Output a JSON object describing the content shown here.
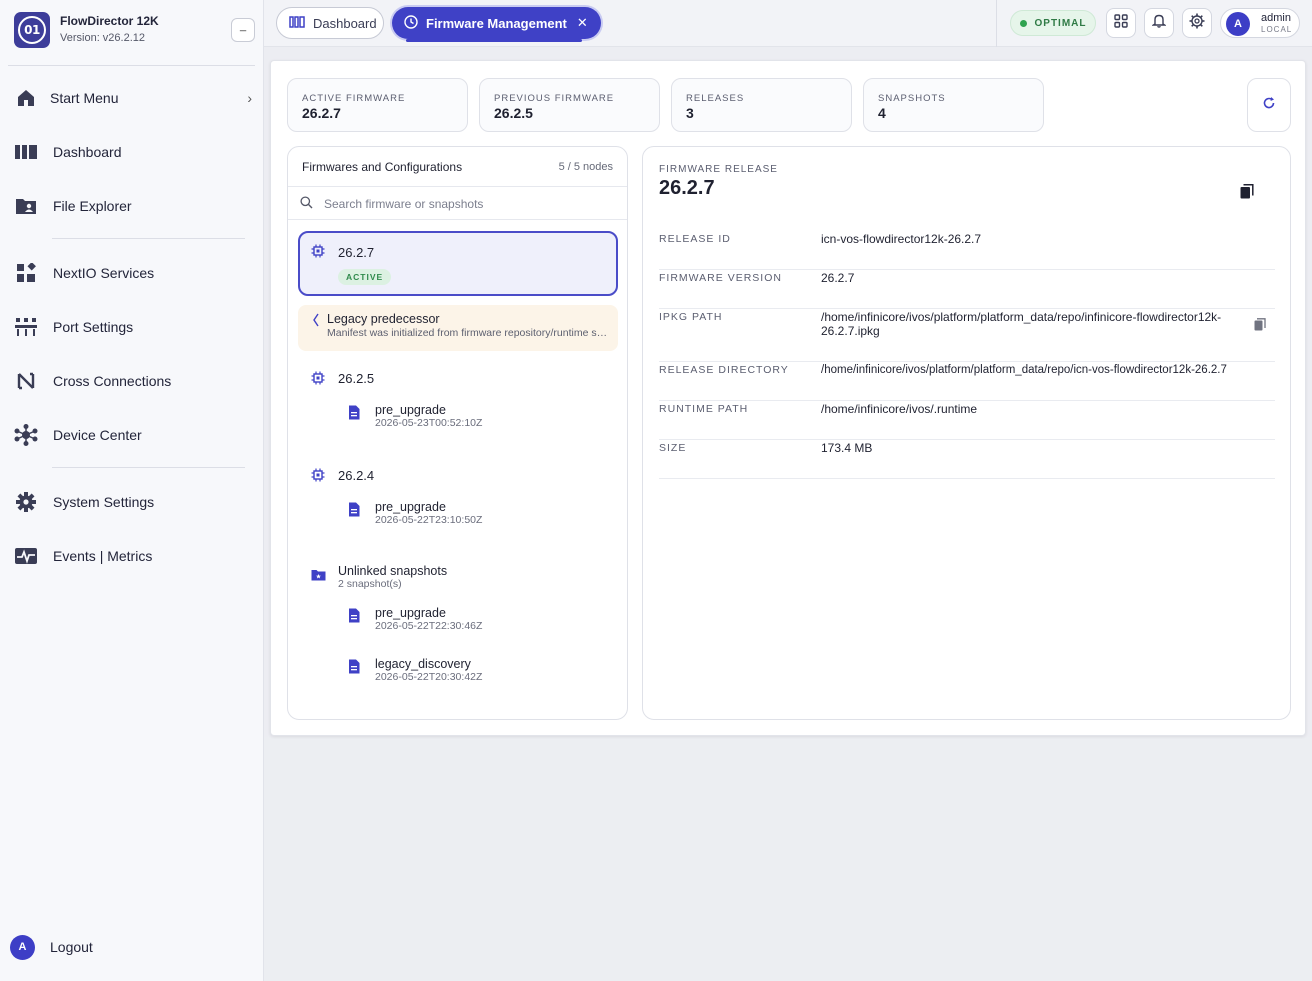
{
  "app": {
    "name": "FlowDirector 12K",
    "version": "Version: v26.2.12",
    "logo_text": "01"
  },
  "sidebar": {
    "collapse_label": "_",
    "items": [
      {
        "label": "Start Menu",
        "icon": "home-icon"
      },
      {
        "label": "Dashboard",
        "icon": "columns-icon"
      },
      {
        "label": "File Explorer",
        "icon": "folder-user-icon"
      },
      {
        "label": "NextIO Services",
        "icon": "widgets-icon"
      },
      {
        "label": "Port Settings",
        "icon": "ports-icon"
      },
      {
        "label": "Cross Connections",
        "icon": "cross-connect-icon"
      },
      {
        "label": "Device Center",
        "icon": "hub-icon"
      },
      {
        "label": "System Settings",
        "icon": "gear-icon"
      },
      {
        "label": "Events | Metrics",
        "icon": "pulse-icon"
      }
    ],
    "logout_label": "Logout",
    "logout_avatar": "A"
  },
  "topbar": {
    "tabs": [
      {
        "label": "Dashboard",
        "active": false
      },
      {
        "label": "Firmware Management",
        "active": true,
        "close": "✕"
      }
    ],
    "status": "OPTIMAL",
    "user": {
      "avatar": "A",
      "name": "admin",
      "role": "LOCAL"
    }
  },
  "stats": [
    {
      "label": "ACTIVE FIRMWARE",
      "value": "26.2.7"
    },
    {
      "label": "PREVIOUS FIRMWARE",
      "value": "26.2.5"
    },
    {
      "label": "RELEASES",
      "value": "3"
    },
    {
      "label": "SNAPSHOTS",
      "value": "4"
    }
  ],
  "tree": {
    "title": "Firmwares and Configurations",
    "count": "5 / 5 nodes",
    "search_placeholder": "Search firmware or snapshots",
    "active_node": {
      "version": "26.2.7",
      "badge": "ACTIVE"
    },
    "legacy": {
      "title": "Legacy predecessor",
      "description": "Manifest was initialized from firmware repository/runtime state"
    },
    "releases": [
      {
        "version": "26.2.5",
        "snapshot": {
          "name": "pre_upgrade",
          "time": "2026-05-23T00:52:10Z"
        }
      },
      {
        "version": "26.2.4",
        "snapshot": {
          "name": "pre_upgrade",
          "time": "2026-05-22T23:10:50Z"
        }
      }
    ],
    "unlinked": {
      "title": "Unlinked snapshots",
      "subtitle": "2 snapshot(s)",
      "snapshots": [
        {
          "name": "pre_upgrade",
          "time": "2026-05-22T22:30:46Z"
        },
        {
          "name": "legacy_discovery",
          "time": "2026-05-22T20:30:42Z"
        }
      ]
    }
  },
  "detail": {
    "kicker": "FIRMWARE RELEASE",
    "title": "26.2.7",
    "props": [
      {
        "key": "RELEASE ID",
        "value": "icn-vos-flowdirector12k-26.2.7"
      },
      {
        "key": "FIRMWARE VERSION",
        "value": "26.2.7"
      },
      {
        "key": "IPKG PATH",
        "value": "/home/infinicore/ivos/platform/platform_data/repo/infinicore-flowdirector12k-26.2.7.ipkg"
      },
      {
        "key": "RELEASE DIRECTORY",
        "value": "/home/infinicore/ivos/platform/platform_data/repo/icn-vos-flowdirector12k-26.2.7"
      },
      {
        "key": "RUNTIME PATH",
        "value": "/home/infinicore/ivos/.runtime"
      },
      {
        "key": "SIZE",
        "value": "173.4 MB"
      }
    ]
  },
  "colors": {
    "accent": "#3f41c6",
    "status_ok": "#2fa34f",
    "legacy_bg": "#fcf4e8"
  }
}
